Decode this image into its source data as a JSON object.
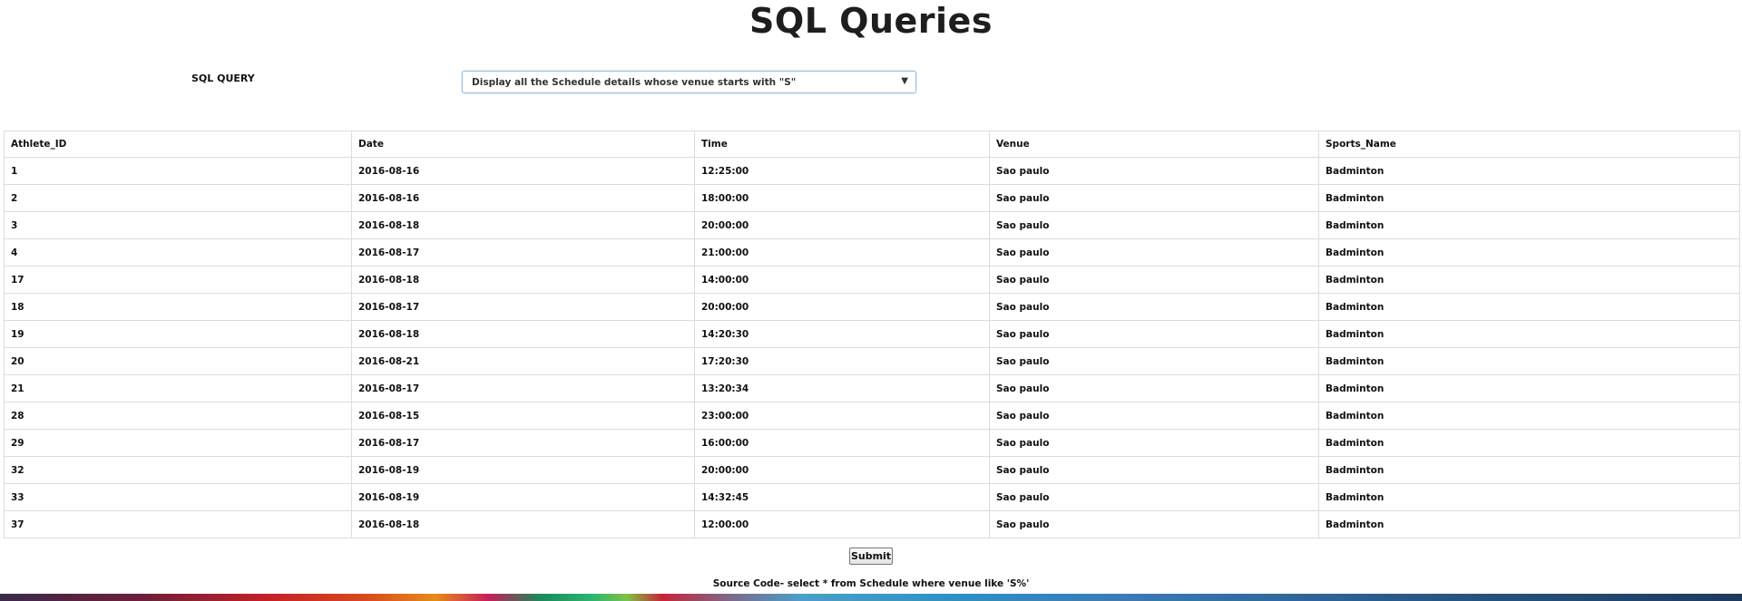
{
  "page": {
    "title": "SQL Queries"
  },
  "query": {
    "label": "SQL QUERY",
    "selected": "Display all the Schedule details whose venue starts with \"S\"",
    "arrow": "▼"
  },
  "table": {
    "columns": [
      "Athlete_ID",
      "Date",
      "Time",
      "Venue",
      "Sports_Name"
    ],
    "rows": [
      [
        "1",
        "2016-08-16",
        "12:25:00",
        "Sao paulo",
        "Badminton"
      ],
      [
        "2",
        "2016-08-16",
        "18:00:00",
        "Sao paulo",
        "Badminton"
      ],
      [
        "3",
        "2016-08-18",
        "20:00:00",
        "Sao paulo",
        "Badminton"
      ],
      [
        "4",
        "2016-08-17",
        "21:00:00",
        "Sao paulo",
        "Badminton"
      ],
      [
        "17",
        "2016-08-18",
        "14:00:00",
        "Sao paulo",
        "Badminton"
      ],
      [
        "18",
        "2016-08-17",
        "20:00:00",
        "Sao paulo",
        "Badminton"
      ],
      [
        "19",
        "2016-08-18",
        "14:20:30",
        "Sao paulo",
        "Badminton"
      ],
      [
        "20",
        "2016-08-21",
        "17:20:30",
        "Sao paulo",
        "Badminton"
      ],
      [
        "21",
        "2016-08-17",
        "13:20:34",
        "Sao paulo",
        "Badminton"
      ],
      [
        "28",
        "2016-08-15",
        "23:00:00",
        "Sao paulo",
        "Badminton"
      ],
      [
        "29",
        "2016-08-17",
        "16:00:00",
        "Sao paulo",
        "Badminton"
      ],
      [
        "32",
        "2016-08-19",
        "20:00:00",
        "Sao paulo",
        "Badminton"
      ],
      [
        "33",
        "2016-08-19",
        "14:32:45",
        "Sao paulo",
        "Badminton"
      ],
      [
        "37",
        "2016-08-18",
        "12:00:00",
        "Sao paulo",
        "Badminton"
      ]
    ]
  },
  "actions": {
    "submit_label": "Submit"
  },
  "footer": {
    "source_code": "Source Code- select * from Schedule where venue like 'S%'"
  }
}
